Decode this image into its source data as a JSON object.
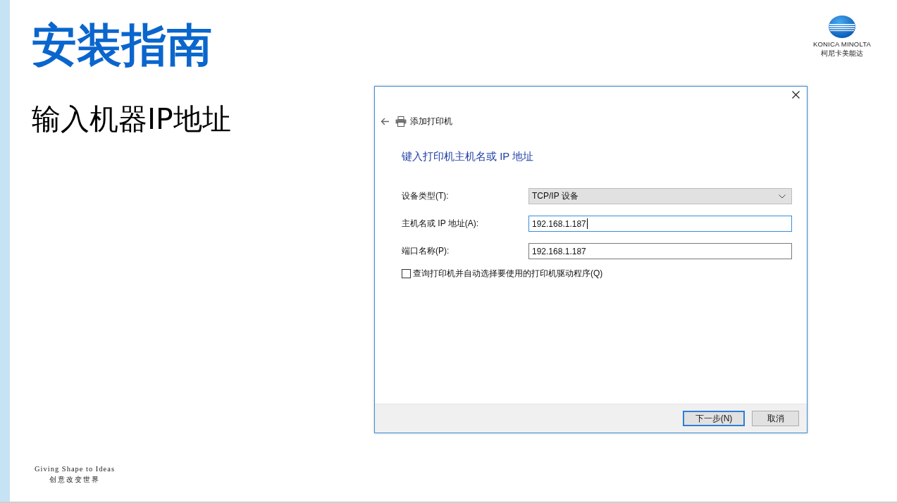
{
  "slide": {
    "title": "安装指南",
    "subtitle": "输入机器IP地址",
    "tagline": "Giving Shape to Ideas",
    "tagline_cn": "创意改变世界"
  },
  "logo": {
    "name": "KONICA MINOLTA",
    "name_cn": "柯尼卡美能达"
  },
  "dialog": {
    "window_title": "添加打印机",
    "heading": "键入打印机主机名或 IP 地址",
    "fields": [
      {
        "kind": "dropdown",
        "label": "设备类型(T):",
        "value": "TCP/IP 设备",
        "focused": false
      },
      {
        "kind": "text",
        "label": "主机名或 IP 地址(A):",
        "value": "192.168.1.187",
        "focused": true
      },
      {
        "kind": "text",
        "label": "端口名称(P):",
        "value": "192.168.1.187",
        "focused": false
      }
    ],
    "checkbox": {
      "label": "查询打印机并自动选择要使用的打印机驱动程序(Q)",
      "checked": false
    },
    "buttons": [
      {
        "label": "下一步(N)",
        "default": true
      },
      {
        "label": "取消",
        "default": false
      }
    ]
  }
}
